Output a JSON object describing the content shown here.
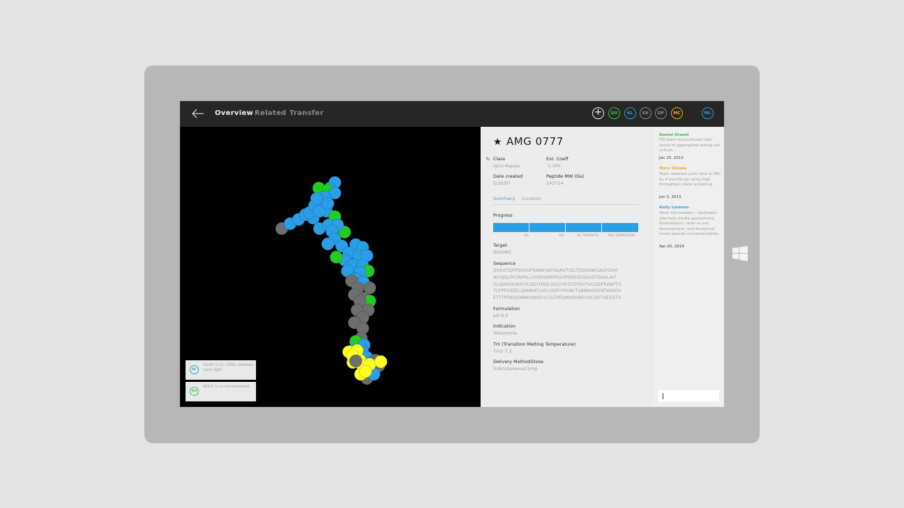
{
  "header": {
    "tabs": [
      {
        "label": "Overview",
        "active": true
      },
      {
        "label": "Related",
        "active": false
      },
      {
        "label": "Transfer",
        "active": false
      }
    ],
    "collaborators": [
      {
        "initials": "DO",
        "color": "#3bbf4a"
      },
      {
        "initials": "KL",
        "color": "#2a9ee6"
      },
      {
        "initials": "KK",
        "color": "#8c8c8c"
      },
      {
        "initials": "DP",
        "color": "#8c8c8c"
      },
      {
        "initials": "MC",
        "color": "#f0a81c"
      }
    ],
    "current_user": {
      "initials": "ML",
      "color": "#2a9ee6"
    }
  },
  "viewer": {
    "notes": [
      {
        "initials": "KL",
        "color": "#2a9ee6",
        "text": "Trp40 in LC CDR1 oxidizes upon light"
      },
      {
        "initials": "DO",
        "color": "#3bbf4a",
        "text": "ADCC is a characterized"
      }
    ]
  },
  "details": {
    "title": "AMG 0777",
    "class_label": "Class",
    "class_value": "IgG2-Kappa",
    "ext_label": "Ext. Coeff",
    "ext_value": "1.300",
    "date_label": "Date created",
    "date_value": "5/20/97",
    "mw_label": "Peptide MW (Da)",
    "mw_value": "143714",
    "subtabs": [
      {
        "label": "Summary",
        "active": true
      },
      {
        "label": "Location",
        "active": false
      }
    ],
    "progress_label": "Progress",
    "progress_fraction": 1.0,
    "milestones": [
      "MA",
      "PSF",
      "QC TRANSFER",
      "2ND SUBMISSION"
    ],
    "target_label": "Target",
    "target_value": "IRHOM2",
    "sequence_label": "Sequence",
    "sequence_lines": [
      "QSVVTQPPSVSGFRANKYAPGQRVTISCTGSSSNIGAGYDVH",
      "WYQQLPGTAPKLLIYGNSNRPSGVPDRFSGSKSGTSASLAIT",
      "GLQAEDEADYYCQSYDSSLSGLYVFGTGTKVTVLGQPKANPTV",
      "TLFPPSSEELQANKATLVCLISDFYPGAVTVAWKADSSPVKAGV",
      "ETTTPSKQSNNKYAASSYLSLTPEQWKSHRSYSCQVTHEGSTV"
    ],
    "formulation_label": "Formulation",
    "formulation_value": "pH 8.0",
    "indication_label": "Indication",
    "indication_value": "Melanoma",
    "tm_label": "Tm (Transition Melting Temperature)",
    "tm_value": "Tm2 7.2",
    "delivery_label": "Delivery Method/Dose",
    "delivery_value": "Subcutaneous/1mg"
  },
  "activity": [
    {
      "name": "Daniel Orwell",
      "color": "#3bbf4a",
      "text": "FIH team encountered high levels of aggregated during cell culture.",
      "date": "Jan 15, 2013"
    },
    {
      "name": "Mary Chinea",
      "color": "#f0a81c",
      "text": "Team reduced cycle time to IND by 4 months by using high throughput clone screening.",
      "date": "Jun 3, 2013"
    },
    {
      "name": "Kelly Lorenzo",
      "color": "#2a9ee6",
      "text": "Work still needed— Upstream: alternate media assessment, Downstream: resin re-use development, and Analytical: minor species characterization.",
      "date": "Apr 20, 2014"
    }
  ],
  "icons": {
    "back": "arrow-left-icon",
    "favorite": "star-icon",
    "edit": "pencil-icon",
    "add": "plus-icon",
    "os": "windows-logo-icon"
  },
  "colors": {
    "accent": "#2a9ee6",
    "atom_blue": "#2a9ee6",
    "atom_green": "#22cc22",
    "atom_gray": "#6e6e6e",
    "atom_yellow": "#ffff22"
  }
}
